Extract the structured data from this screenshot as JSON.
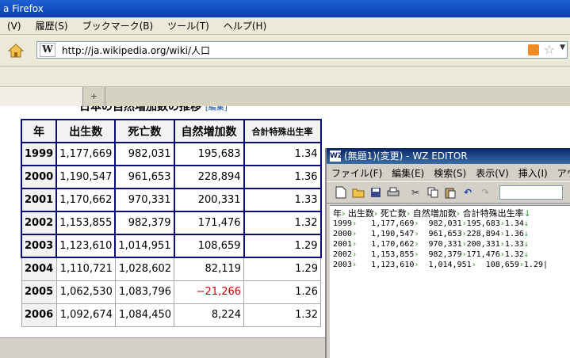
{
  "firefox": {
    "title": "a Firefox",
    "menu": [
      "(V)",
      "履歴(S)",
      "ブックマーク(B)",
      "ツール(T)",
      "ヘルプ(H)"
    ],
    "site_icon": "W",
    "url": "http://ja.wikipedia.org/wiki/人口",
    "new_tab": "+"
  },
  "page": {
    "section_title": "日本の自然増加数の推移",
    "edit_link": "[編集]",
    "table": {
      "headers": [
        "年",
        "出生数",
        "死亡数",
        "自然増加数",
        "合計特殊出生率"
      ],
      "rows": [
        [
          "1999",
          "1,177,669",
          "982,031",
          "195,683",
          "1.34"
        ],
        [
          "2000",
          "1,190,547",
          "961,653",
          "228,894",
          "1.36"
        ],
        [
          "2001",
          "1,170,662",
          "970,331",
          "200,331",
          "1.33"
        ],
        [
          "2002",
          "1,153,855",
          "982,379",
          "171,476",
          "1.32"
        ],
        [
          "2003",
          "1,123,610",
          "1,014,951",
          "108,659",
          "1.29"
        ],
        [
          "2004",
          "1,110,721",
          "1,028,602",
          "82,119",
          "1.29"
        ],
        [
          "2005",
          "1,062,530",
          "1,083,796",
          "−21,266",
          "1.26"
        ],
        [
          "2006",
          "1,092,674",
          "1,084,450",
          "8,224",
          "1.32"
        ]
      ]
    }
  },
  "wz_editor": {
    "title": "(無題1)(変更) - WZ EDITOR",
    "logo": "WZ",
    "menu": [
      "ファイル(F)",
      "編集(E)",
      "検索(S)",
      "表示(V)",
      "挿入(I)",
      "アウト"
    ],
    "lines": [
      [
        "年",
        "出生数",
        "死亡数",
        "自然増加数",
        "合計特殊出生率"
      ],
      [
        "1999",
        "   1,177,669",
        "  982,031",
        "195,683",
        "1.34"
      ],
      [
        "2000",
        "   1,190,547",
        "  961,653",
        "228,894",
        "1.36"
      ],
      [
        "2001",
        "   1,170,662",
        "  970,331",
        "200,331",
        "1.33"
      ],
      [
        "2002",
        "   1,153,855",
        "  982,379",
        "171,476",
        "1.32"
      ],
      [
        "2003",
        "   1,123,610",
        "  1,014,951",
        "  108,659",
        "1.29"
      ]
    ]
  },
  "icons": {
    "home": "home-icon",
    "rss": "rss-icon",
    "bookmark": "star-icon"
  },
  "colors": {
    "negative": "#d40000",
    "selection_border": "#0d0d7a",
    "tab_mark": "#2a9d2a"
  }
}
